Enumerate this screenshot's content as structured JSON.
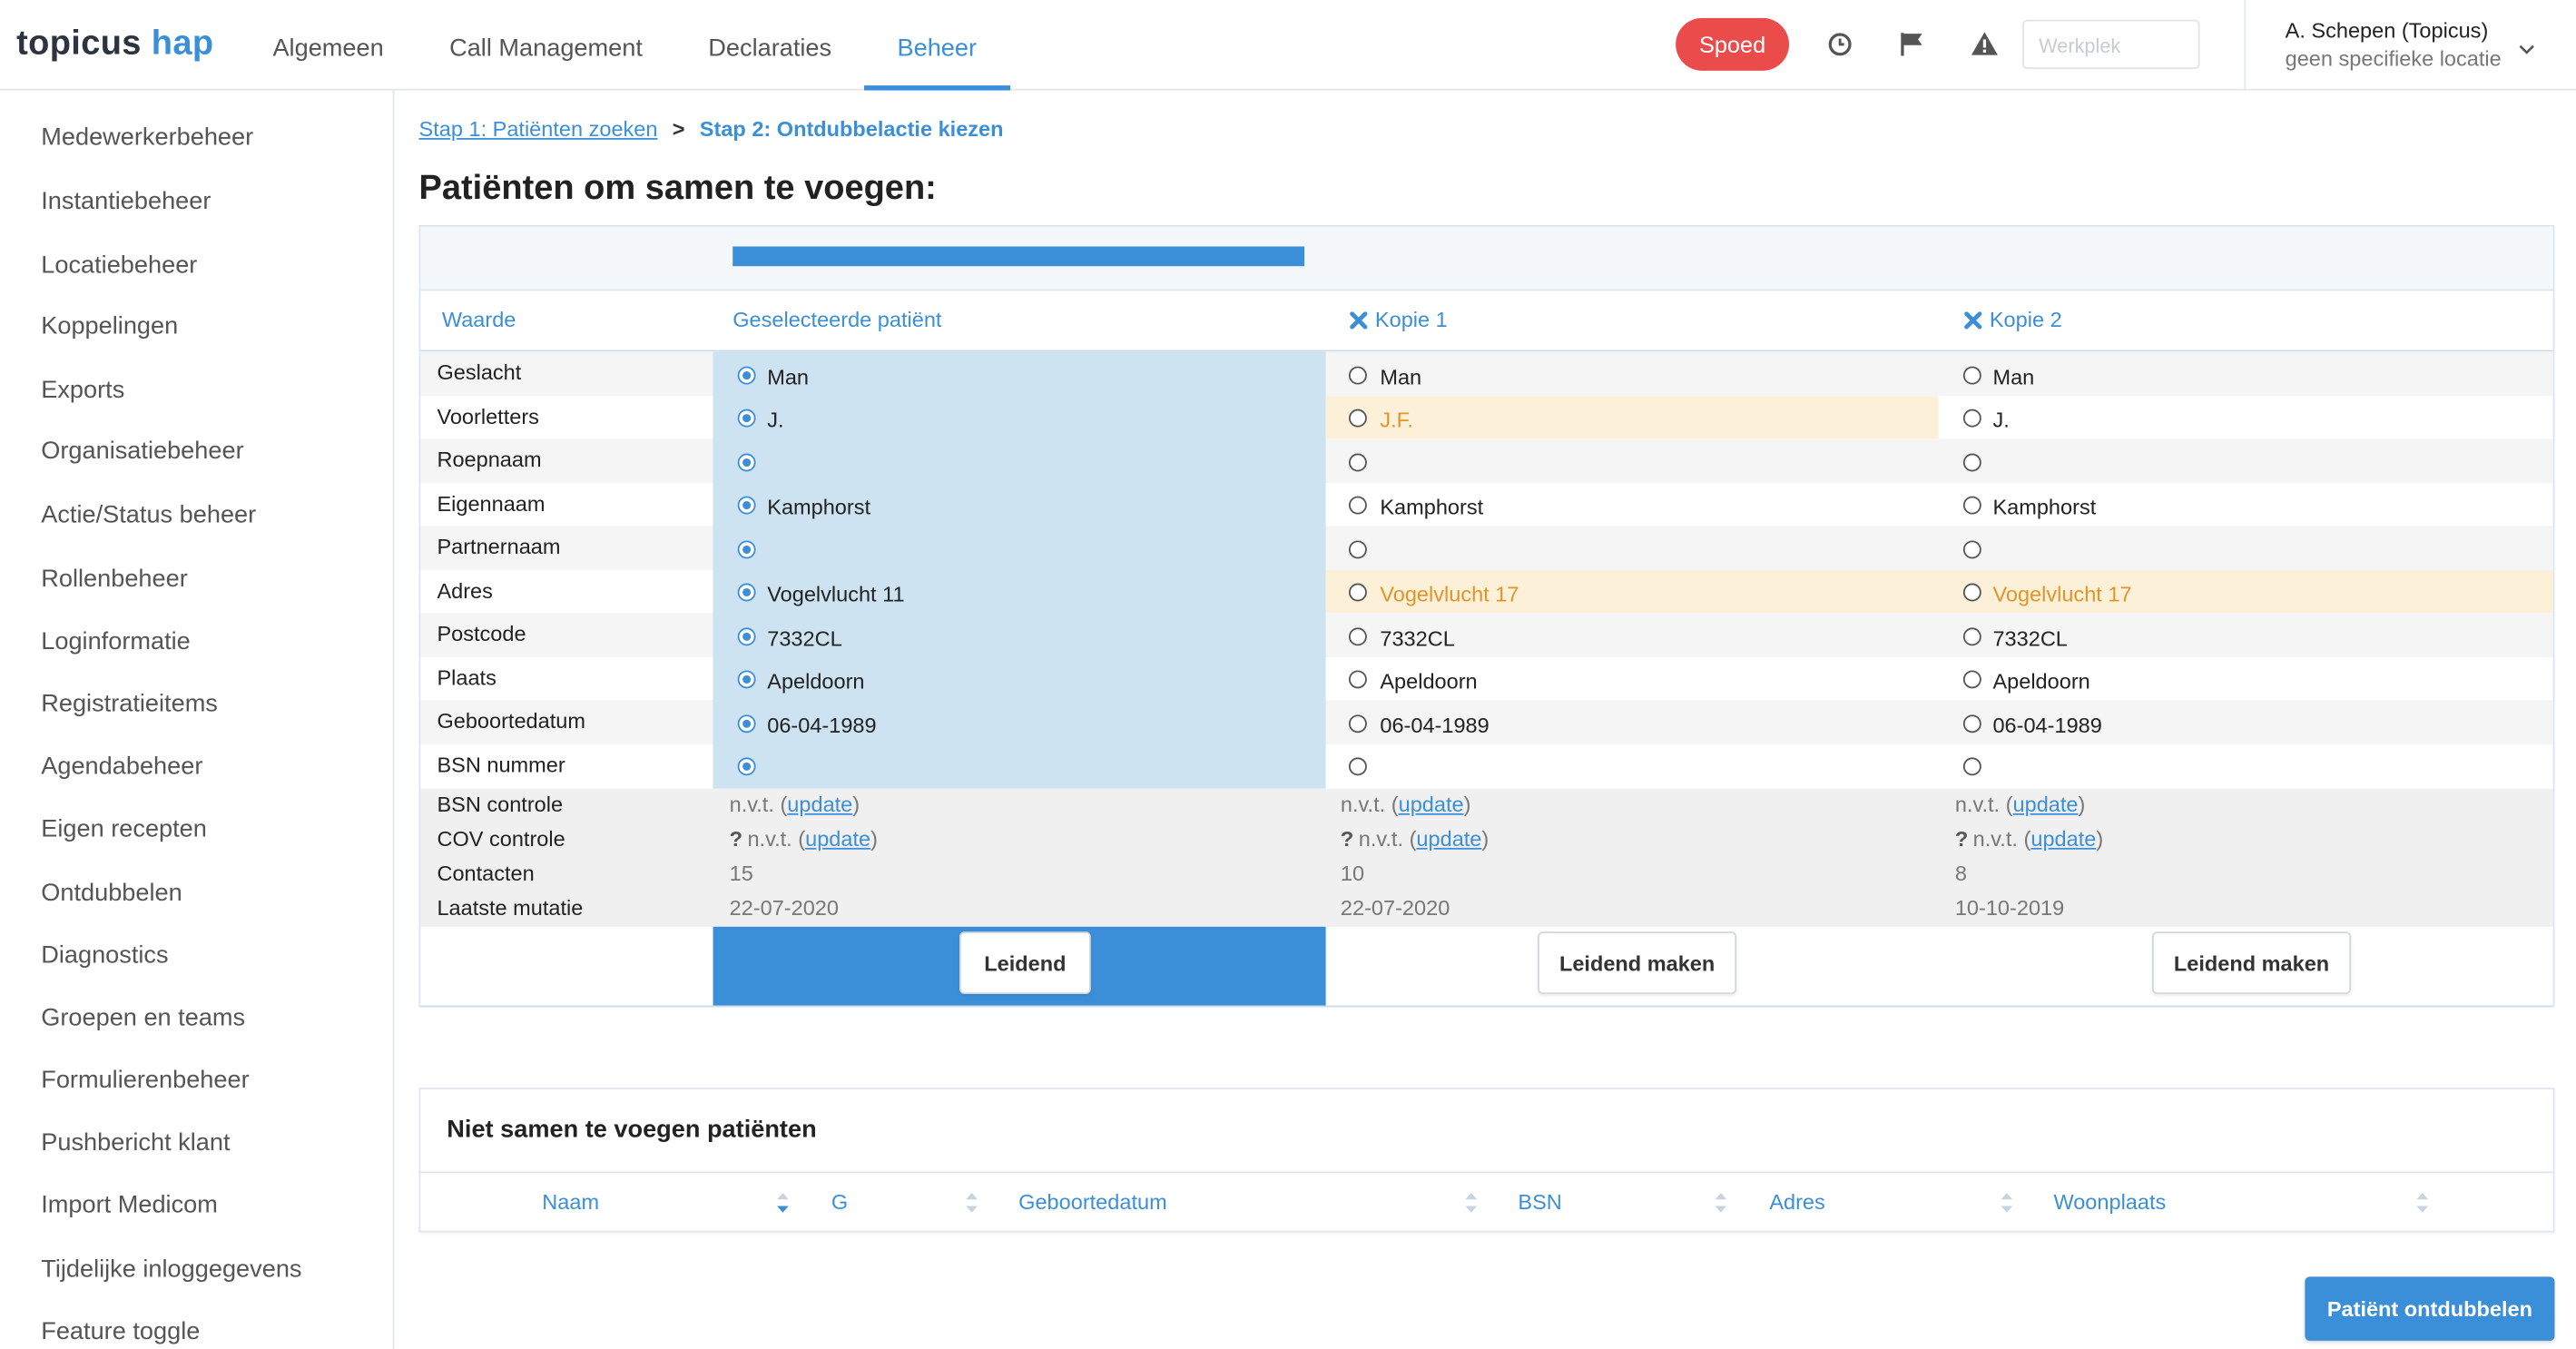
{
  "header": {
    "logo_part1": "topicus",
    "logo_part2": "hap",
    "nav": [
      "Algemeen",
      "Call Management",
      "Declaraties",
      "Beheer"
    ],
    "active_nav": "Beheer",
    "spoed_label": "Spoed",
    "werkplek_placeholder": "Werkplek",
    "user_name": "A. Schepen (Topicus)",
    "user_location": "geen specifieke locatie",
    "icons": [
      "clock-icon",
      "flag-icon",
      "warning-icon",
      "chevron-down-icon"
    ]
  },
  "sidebar": {
    "items": [
      "Medewerkerbeheer",
      "Instantiebeheer",
      "Locatiebeheer",
      "Koppelingen",
      "Exports",
      "Organisatiebeheer",
      "Actie/Status beheer",
      "Rollenbeheer",
      "Loginformatie",
      "Registratieitems",
      "Agendabeheer",
      "Eigen recepten",
      "Ontdubbelen",
      "Diagnostics",
      "Groepen en teams",
      "Formulierenbeheer",
      "Pushbericht klant",
      "Import Medicom",
      "Tijdelijke inloggegevens",
      "Feature toggle"
    ]
  },
  "breadcrumb": {
    "step1": "Stap 1: Patiënten zoeken",
    "separator": ">",
    "step2": "Stap 2: Ontdubbelactie kiezen"
  },
  "title": "Patiënten om samen te voegen:",
  "merge": {
    "progress_percent": 27,
    "headers": {
      "waarde": "Waarde",
      "selected": "Geselecteerde patiënt",
      "copy1": "Kopie 1",
      "copy2": "Kopie 2"
    },
    "fields": [
      {
        "label": "Geslacht",
        "sel": "Man",
        "c1": "Man",
        "c2": "Man"
      },
      {
        "label": "Voorletters",
        "sel": "J.",
        "c1": "J.F.",
        "c2": "J."
      },
      {
        "label": "Roepnaam",
        "sel": "",
        "c1": "",
        "c2": ""
      },
      {
        "label": "Eigennaam",
        "sel": "Kamphorst",
        "c1": "Kamphorst",
        "c2": "Kamphorst"
      },
      {
        "label": "Partnernaam",
        "sel": "",
        "c1": "",
        "c2": ""
      },
      {
        "label": "Adres",
        "sel": "Vogelvlucht 11",
        "c1": "Vogelvlucht 17",
        "c2": "Vogelvlucht 17"
      },
      {
        "label": "Postcode",
        "sel": "7332CL",
        "c1": "7332CL",
        "c2": "7332CL"
      },
      {
        "label": "Plaats",
        "sel": "Apeldoorn",
        "c1": "Apeldoorn",
        "c2": "Apeldoorn"
      },
      {
        "label": "Geboortedatum",
        "sel": "06-04-1989",
        "c1": "06-04-1989",
        "c2": "06-04-1989"
      },
      {
        "label": "BSN nummer",
        "sel": "",
        "c1": "",
        "c2": ""
      }
    ],
    "info": [
      {
        "label": "BSN controle",
        "sel": "n.v.t.",
        "c1": "n.v.t.",
        "c2": "n.v.t."
      },
      {
        "label": "COV controle",
        "sel": "n.v.t.",
        "c1": "n.v.t.",
        "c2": "n.v.t."
      },
      {
        "label": "Contacten",
        "sel": "15",
        "c1": "10",
        "c2": "8"
      },
      {
        "label": "Laatste mutatie",
        "sel": "22-07-2020",
        "c1": "22-07-2020",
        "c2": "10-10-2019"
      }
    ],
    "update_label": "update",
    "q_mark": "?",
    "open_paren": "(",
    "close_paren": ")",
    "leidend_label": "Leidend",
    "leidend_maken_label": "Leidend maken"
  },
  "not_merge": {
    "title": "Niet samen te voegen patiënten",
    "columns": [
      "Naam",
      "G",
      "Geboortedatum",
      "BSN",
      "Adres",
      "Woonplaats"
    ]
  },
  "primary_button": "Patiënt ontdubbelen",
  "colors": {
    "accent": "#3b8fd8",
    "spoed": "#ea4b4b",
    "warn": "#e0952a",
    "selected_bg": "#cde3f2",
    "highlight_bg": "#fdf0d9"
  }
}
